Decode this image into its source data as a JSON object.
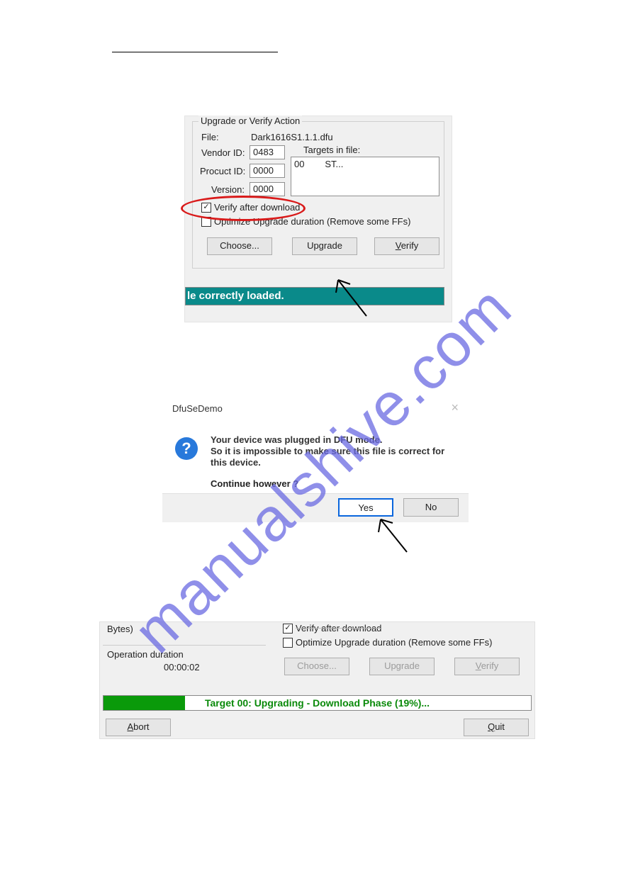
{
  "panel1": {
    "group_title": "Upgrade or Verify Action",
    "file_label": "File:",
    "file_value": "Dark1616S1.1.1.dfu",
    "vendor_label": "Vendor ID:",
    "vendor_value": "0483",
    "product_label": "Procuct ID:",
    "product_value": "0000",
    "version_label": "Version:",
    "version_value": "0000",
    "targets_label": "Targets in file:",
    "target_row": "00        ST...",
    "verify_chk_label": "Verify after download",
    "optimize_chk_label": "Optimize Upgrade duration (Remove some FFs)",
    "choose_btn": "Choose...",
    "upgrade_btn": "Upgrade",
    "verify_btn": "Verify",
    "status": "le correctly loaded."
  },
  "dialog": {
    "title": "DfuSeDemo",
    "icon_text": "?",
    "line1": "Your device was plugged in DFU mode.",
    "line2": "So it is impossible to make sure this file is correct for this device.",
    "line3": "Continue however ?",
    "yes": "Yes",
    "no": "No",
    "close": "×"
  },
  "panel3": {
    "bytes_label": "Bytes)",
    "op_label": "Operation duration",
    "op_value": "00:00:02",
    "verify_chk_label": "Verify after download",
    "optimize_chk_label": "Optimize Upgrade duration (Remove some FFs)",
    "choose_btn": "Choose...",
    "upgrade_btn": "Upgrade",
    "verify_btn": "Verify",
    "progress_text": "Target 00: Upgrading - Download Phase (19%)...",
    "abort": "Abort",
    "quit": "Quit"
  },
  "watermark": "manualshive.com"
}
